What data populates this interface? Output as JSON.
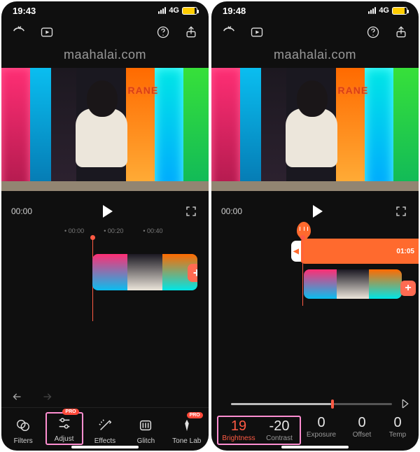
{
  "left": {
    "status": {
      "time": "19:43",
      "net": "4G"
    },
    "watermark": "maahalai.com",
    "arcade_sign": "RANE",
    "controls": {
      "current_time": "00:00"
    },
    "ruler": [
      "00:00",
      "00:20",
      "00:40"
    ],
    "tools": {
      "filters": "Filters",
      "adjust": "Adjust",
      "effects": "Effects",
      "glitch": "Glitch",
      "tonelab": "Tone Lab",
      "pro_badge": "PRO"
    }
  },
  "right": {
    "status": {
      "time": "19:48",
      "net": "4G"
    },
    "watermark": "maahalai.com",
    "arcade_sign": "RANE",
    "controls": {
      "current_time": "00:00"
    },
    "clip": {
      "duration": "01:05"
    },
    "params": {
      "brightness": {
        "value": "19",
        "label": "Brightness"
      },
      "contrast": {
        "value": "-20",
        "label": "Contrast"
      },
      "exposure": {
        "value": "0",
        "label": "Exposure"
      },
      "offset": {
        "value": "0",
        "label": "Offset"
      },
      "temp": {
        "value": "0",
        "label": "Temp"
      }
    }
  }
}
